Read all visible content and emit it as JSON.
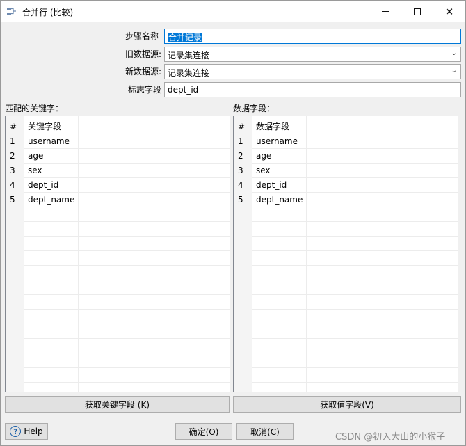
{
  "window": {
    "title": "合并行 (比较)"
  },
  "form": {
    "step_name_label": "步骤名称",
    "step_name_value": "合并记录",
    "old_source_label": "旧数据源:",
    "old_source_value": "记录集连接",
    "new_source_label": "新数据源:",
    "new_source_value": "记录集连接",
    "flag_field_label": "标志字段",
    "flag_field_value": "dept_id"
  },
  "keys_section": {
    "label": "匹配的关键字：",
    "headers": [
      "#",
      "关键字段"
    ],
    "rows": [
      {
        "num": "1",
        "field": "username"
      },
      {
        "num": "2",
        "field": "age"
      },
      {
        "num": "3",
        "field": "sex"
      },
      {
        "num": "4",
        "field": "dept_id"
      },
      {
        "num": "5",
        "field": "dept_name"
      }
    ],
    "button": "获取关键字段 (K)"
  },
  "data_section": {
    "label": "数据字段：",
    "headers": [
      "#",
      "数据字段"
    ],
    "rows": [
      {
        "num": "1",
        "field": "username"
      },
      {
        "num": "2",
        "field": "age"
      },
      {
        "num": "3",
        "field": "sex"
      },
      {
        "num": "4",
        "field": "dept_id"
      },
      {
        "num": "5",
        "field": "dept_name"
      }
    ],
    "button": "获取值字段(V)"
  },
  "footer": {
    "help": "Help",
    "ok": "确定(O)",
    "cancel": "取消(C)"
  },
  "watermark": "CSDN @初入大山的小猴子",
  "colors": {
    "selection": "#0078d7",
    "help_icon": "#1a5fa8"
  },
  "icons": {
    "help": "question-circle-icon",
    "app": "merge-rows-icon"
  }
}
